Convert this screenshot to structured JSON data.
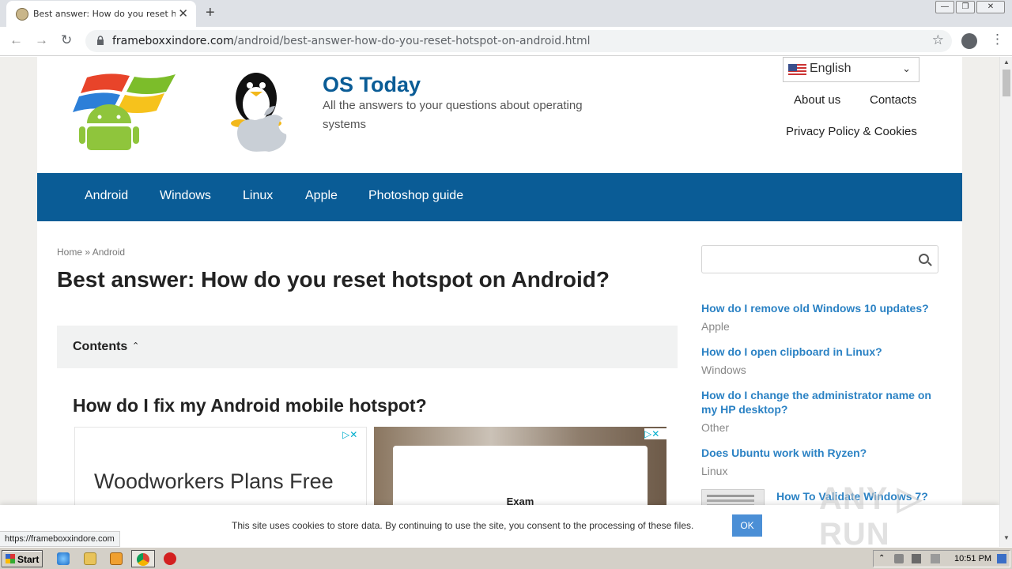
{
  "browser": {
    "tab_title": "Best answer: How do you reset hots",
    "tab_close": "✕",
    "new_tab": "+",
    "url_domain": "frameboxxindore.com",
    "url_path": "/android/best-answer-how-do-you-reset-hotspot-on-android.html",
    "back_glyph": "←",
    "forward_glyph": "→",
    "reload_glyph": "↻",
    "star_glyph": "☆",
    "menu_glyph": "⋮",
    "status_url": "https://frameboxxindore.com"
  },
  "site": {
    "title": "OS Today",
    "description": "All the answers to your questions about operating systems",
    "language": "English",
    "top_links": [
      "About us",
      "Contacts",
      "Privacy Policy & Cookies"
    ]
  },
  "nav": {
    "items": [
      "Android",
      "Windows",
      "Linux",
      "Apple",
      "Photoshop guide"
    ]
  },
  "article": {
    "breadcrumb": "Home » Android",
    "title": "Best answer: How do you reset hotspot on Android?",
    "contents_label": "Contents",
    "contents_toggle": "⌃",
    "subheading": "How do I fix my Android mobile hotspot?"
  },
  "ads": {
    "ad1_headline": "Woodworkers Plans Free",
    "ad2_text": "Exam",
    "adchoices": "▷✕"
  },
  "sidebar": {
    "links": [
      {
        "title": "How do I remove old Windows 10 updates?",
        "category": "Apple"
      },
      {
        "title": "How do I open clipboard in Linux?",
        "category": "Windows"
      },
      {
        "title": "How do I change the administrator name on my HP desktop?",
        "category": "Other"
      },
      {
        "title": "Does Ubuntu work with Ryzen?",
        "category": "Linux"
      },
      {
        "title": "How To Validate Windows 7?",
        "category": ""
      }
    ]
  },
  "cookie": {
    "message": "This site uses cookies to store data. By continuing to use the site, you consent to the processing of these files.",
    "ok_label": "OK"
  },
  "watermark": "ANY ▷ RUN",
  "taskbar": {
    "start_label": "Start",
    "clock": "10:51 PM"
  },
  "colors": {
    "brand_blue": "#0a5c96",
    "link_blue": "#2b82c4",
    "ok_button": "#4b8fd6"
  }
}
